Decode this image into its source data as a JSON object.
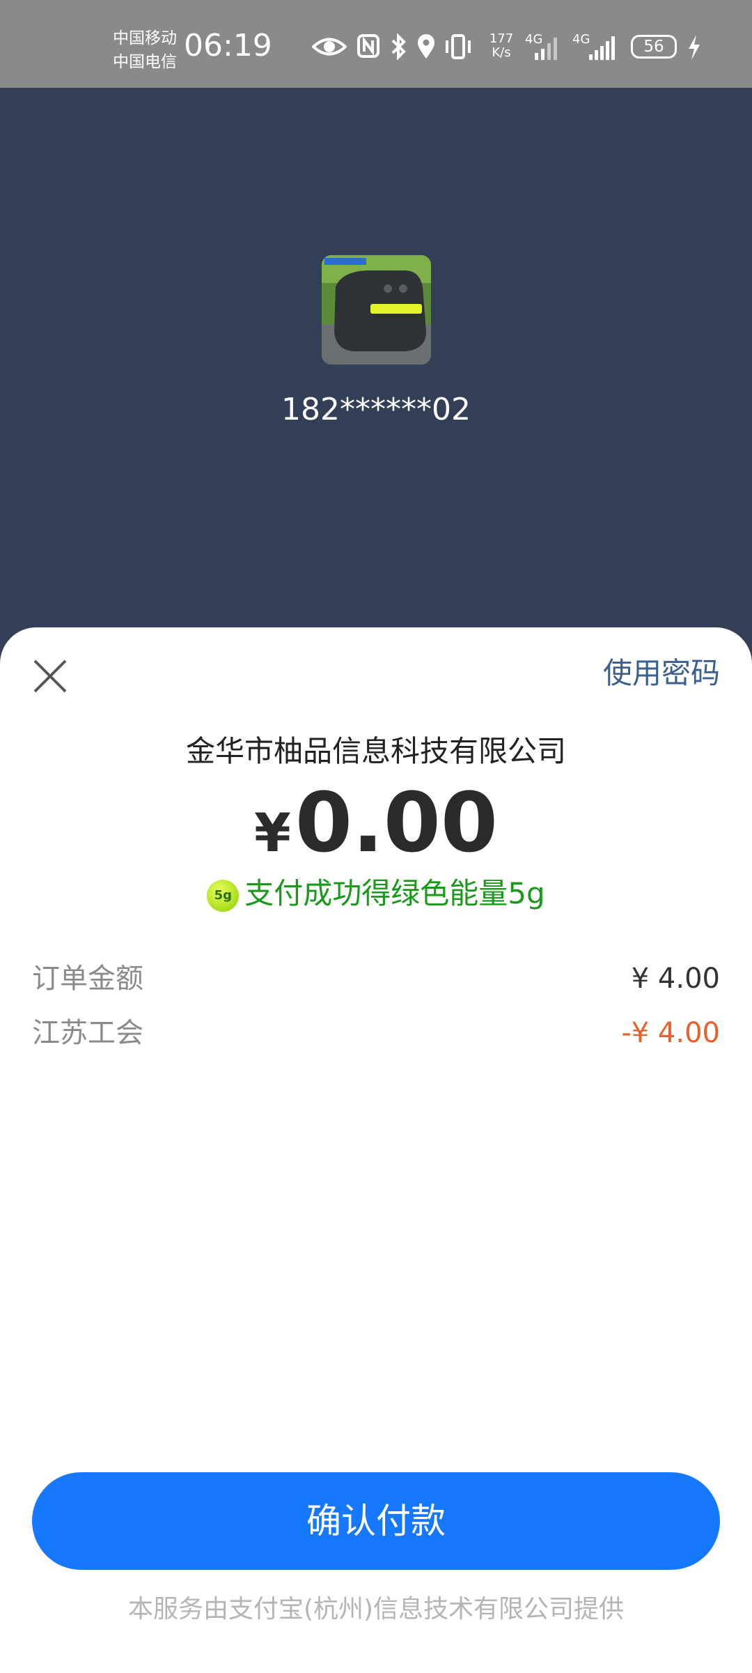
{
  "status_bar": {
    "carrier_1": "中国移动",
    "carrier_2": "中国电信",
    "time": "06:19",
    "speed_value": "177",
    "speed_unit": "K/s",
    "network_1": "4G",
    "network_2": "4G",
    "battery": "56",
    "icons": [
      "eye-icon",
      "nfc-icon",
      "bluetooth-icon",
      "location-icon",
      "vibrate-icon",
      "signal-icon",
      "signal-icon",
      "battery-icon",
      "charging-icon"
    ]
  },
  "header": {
    "account": "182******02"
  },
  "sheet": {
    "use_password": "使用密码",
    "merchant": "金华市柚品信息科技有限公司",
    "currency": "¥",
    "amount": "0.00",
    "energy_badge": "5g",
    "energy_text": "支付成功得绿色能量5g",
    "rows": [
      {
        "label": "订单金额",
        "value": "¥ 4.00"
      },
      {
        "label": "江苏工会",
        "value": "-¥ 4.00"
      }
    ],
    "confirm": "确认付款",
    "footer": "本服务由支付宝(杭州)信息技术有限公司提供"
  },
  "colors": {
    "primary": "#1677ff",
    "energy": "#1a9a1a",
    "discount": "#e8612c",
    "header_bg": "#333f57"
  }
}
